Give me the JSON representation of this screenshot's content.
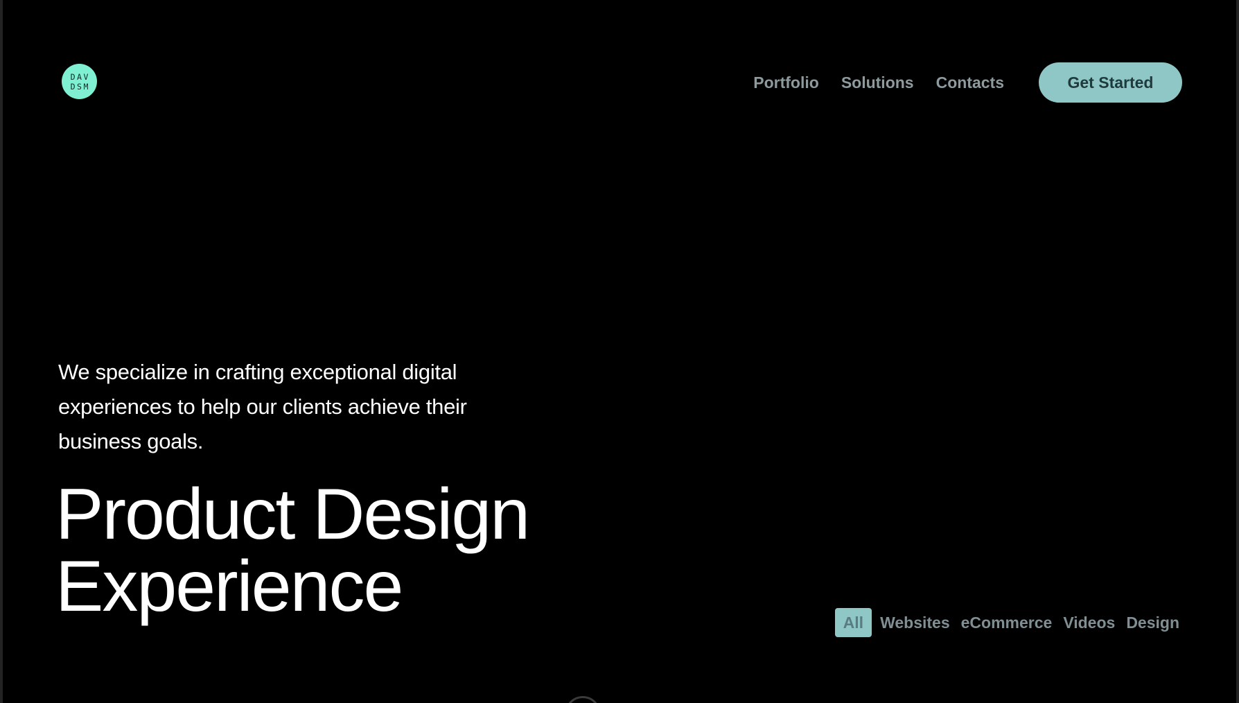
{
  "logo": {
    "line1": "DAV",
    "line2": "DSM"
  },
  "nav": {
    "items": [
      {
        "label": "Portfolio"
      },
      {
        "label": "Solutions"
      },
      {
        "label": "Contacts"
      }
    ],
    "cta_label": "Get Started"
  },
  "hero": {
    "tagline": "We specialize in crafting exceptional digital experiences to help our clients achieve their business goals.",
    "headline_line1": "Product Design",
    "headline_line2": "Experience"
  },
  "filters": {
    "items": [
      {
        "label": "All",
        "active": true
      },
      {
        "label": "Websites",
        "active": false
      },
      {
        "label": "eCommerce",
        "active": false
      },
      {
        "label": "Videos",
        "active": false
      },
      {
        "label": "Design",
        "active": false
      }
    ]
  },
  "colors": {
    "background": "#000000",
    "logo": "#7ff0d2",
    "accent": "#8fc7c6",
    "muted_text": "#8d9a9e",
    "text": "#ffffff"
  }
}
